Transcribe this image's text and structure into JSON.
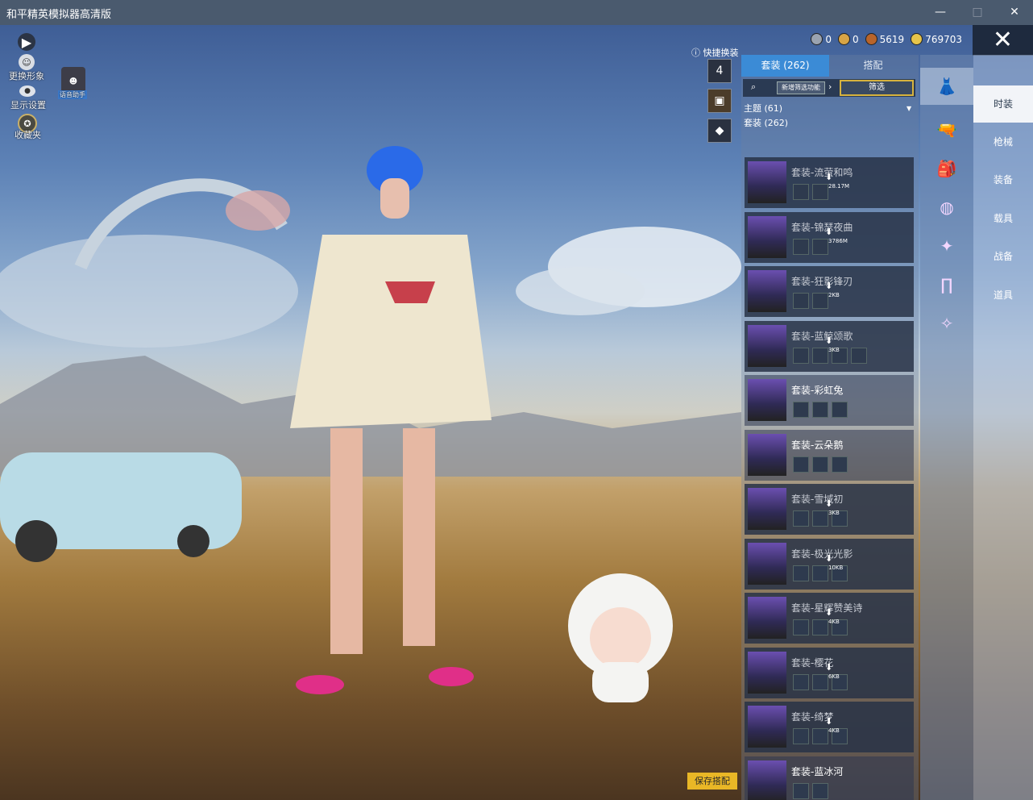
{
  "window": {
    "title": "和平精英模拟器高清版",
    "minimize": "—",
    "maximize": "□",
    "close": "✕"
  },
  "left_menu": {
    "items": [
      {
        "label": "更换形象",
        "icon": "avatar-icon"
      },
      {
        "label": "显示设置",
        "icon": "eye-icon"
      },
      {
        "label": "收藏夹",
        "icon": "badge-icon"
      }
    ],
    "assistant_label": "语音助手"
  },
  "currency": [
    {
      "value": "0",
      "color": "#9aa3b0"
    },
    {
      "value": "0",
      "color": "#d7a445"
    },
    {
      "value": "5619",
      "color": "#b8642a"
    },
    {
      "value": "769703",
      "color": "#e6c44a"
    }
  ],
  "quick_change": {
    "label": "快捷换装",
    "badge": "4"
  },
  "panel": {
    "tabs": [
      {
        "label": "套装 (262)",
        "active": true
      },
      {
        "label": "搭配",
        "active": false
      }
    ],
    "new_feature": "新增筛选功能",
    "filter": "筛选",
    "theme": "主题 (61)",
    "suit_count": "套装 (262)",
    "items": [
      {
        "name": "套装-流萤和鸣",
        "size": "28.17M",
        "downloaded": false,
        "minis": 2
      },
      {
        "name": "套装-锦瑟夜曲",
        "size": "3786M",
        "downloaded": false,
        "minis": 2
      },
      {
        "name": "套装-狂影锋刃",
        "size": "2KB",
        "downloaded": false,
        "minis": 2
      },
      {
        "name": "套装-蓝鲸颂歌",
        "size": "3KB",
        "downloaded": false,
        "minis": 4
      },
      {
        "name": "套装-彩虹兔",
        "size": "",
        "downloaded": true,
        "minis": 3
      },
      {
        "name": "套装-云朵鹅",
        "size": "",
        "downloaded": true,
        "minis": 3
      },
      {
        "name": "套装-雪域初",
        "size": "3KB",
        "downloaded": false,
        "minis": 3
      },
      {
        "name": "套装-极光光影",
        "size": "10KB",
        "downloaded": false,
        "minis": 3
      },
      {
        "name": "套装-星辉赞美诗",
        "size": "4KB",
        "downloaded": false,
        "minis": 3
      },
      {
        "name": "套装-樱花",
        "size": "6KB",
        "downloaded": false,
        "minis": 3
      },
      {
        "name": "套装-绮梦",
        "size": "4KB",
        "downloaded": false,
        "minis": 3
      },
      {
        "name": "套装-蓝冰河",
        "size": "",
        "downloaded": true,
        "minis": 2
      }
    ]
  },
  "categories": {
    "icons": [
      "outfit-icon",
      "gun-icon",
      "equipment-icon",
      "mask-icon",
      "vehicle-icon",
      "pants-icon",
      "item-icon"
    ],
    "labels": [
      {
        "label": "时装",
        "active": true
      },
      {
        "label": "枪械",
        "active": false
      },
      {
        "label": "装备",
        "active": false
      },
      {
        "label": "载具",
        "active": false
      },
      {
        "label": "战备",
        "active": false
      },
      {
        "label": "道具",
        "active": false
      }
    ]
  },
  "save_button": "保存搭配"
}
